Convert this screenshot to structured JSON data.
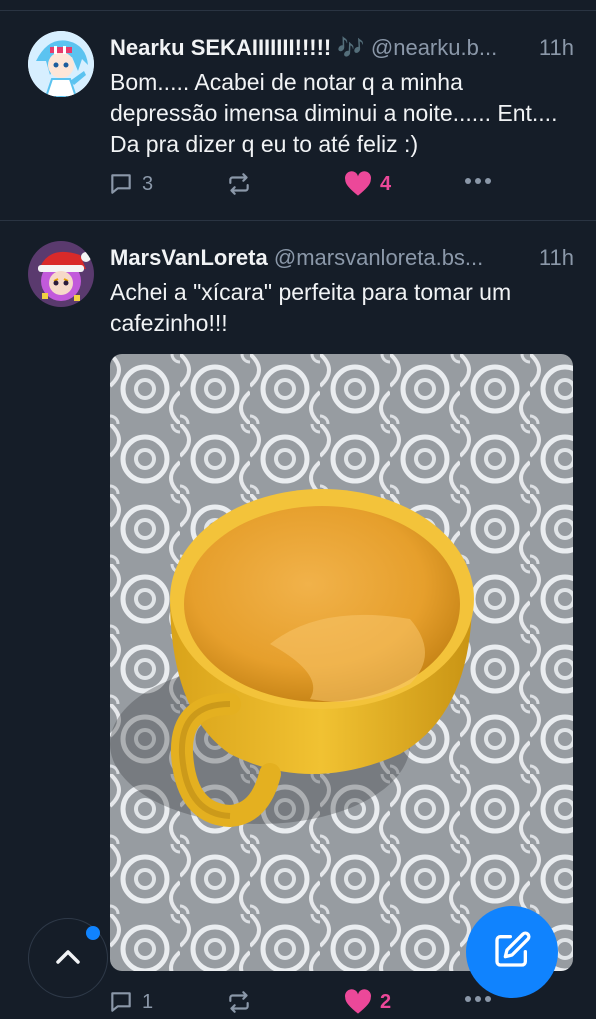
{
  "posts": [
    {
      "author": "Nearku SEKAIIIIIII!!!!! 🎶",
      "handle": "@nearku.b...",
      "time": "11h",
      "text": "Bom..... Acabei de notar q a minha depressão imensa diminui a noite...... Ent.... Da pra dizer q eu to até feliz :)",
      "replies": "3",
      "likes": "4",
      "liked": true
    },
    {
      "author": "MarsVanLoreta",
      "handle": "@marsvanloreta.bs...",
      "time": "11h",
      "text": "Achei a \"xícara\" perfeita para tomar um cafezinho!!!",
      "image": "yellow-cup-on-lace-tablecloth",
      "replies": "1",
      "likes": "2",
      "liked": true
    }
  ],
  "colors": {
    "accent": "#1083fe",
    "like": "#ec4899",
    "background": "#151d28",
    "muted": "#8b98a9"
  },
  "icons": [
    "reply-icon",
    "repost-icon",
    "heart-icon",
    "more-icon",
    "chevron-up-icon",
    "compose-icon"
  ]
}
